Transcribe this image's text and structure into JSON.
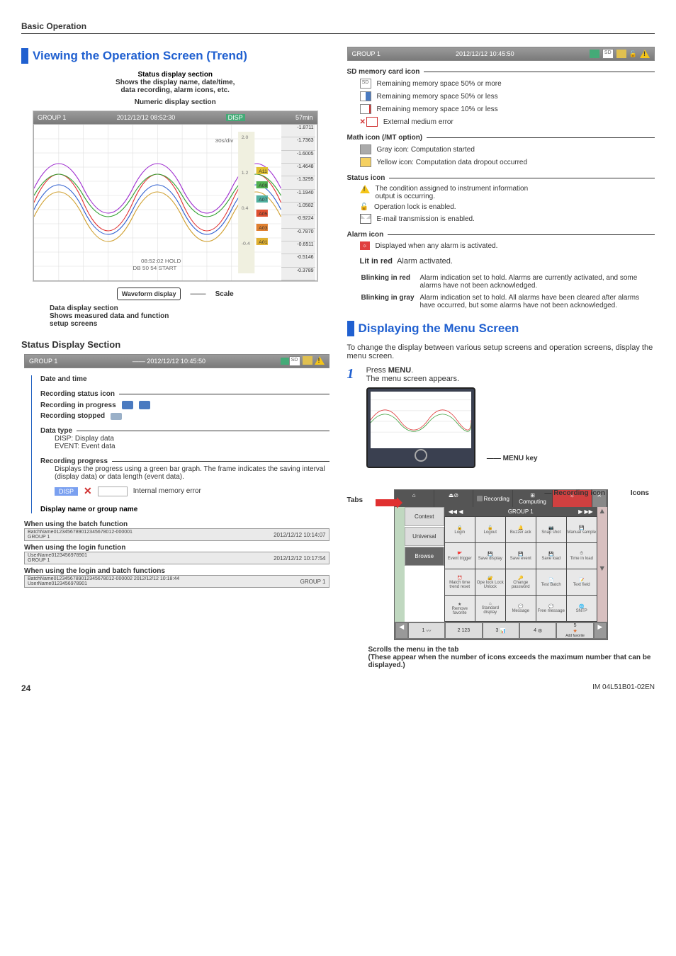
{
  "header": {
    "title": "Basic Operation"
  },
  "left": {
    "title1": "Viewing the Operation Screen (Trend)",
    "annot": {
      "status_title": "Status display section",
      "status_desc1": "Shows the display name, date/time,",
      "status_desc2": "data recording, alarm icons, etc.",
      "numeric": "Numeric display section",
      "waveform": "Waveform display",
      "scale": "Scale",
      "data_title": "Data display section",
      "data_desc1": "Shows measured data and function",
      "data_desc2": "setup screens"
    },
    "trend_statusbar": {
      "group": "GROUP 1",
      "datetime": "2012/12/12 08:52:30",
      "disp": "DISP",
      "period": "57min"
    },
    "trend_values": [
      "-1.8711",
      "-1.7363",
      "-1.6005",
      "-1.4648",
      "-1.3295",
      "-1.1940",
      "-1.0582",
      "-0.9224",
      "-0.7870",
      "-0.6511",
      "-0.5146",
      "-0.3789"
    ],
    "trend_scale_labels": [
      "30s/div",
      "2.0",
      "1.2",
      "0.4",
      "-0.4"
    ],
    "trend_time_labels": [
      "08:52:02 HOLD",
      "DB 50 54 START"
    ],
    "sub_title": "Status Display Section",
    "mini_statusbar": {
      "group": "GROUP 1",
      "datetime": "2012/12/12 10:45:50"
    },
    "block1": {
      "l1": "Date and time",
      "l2": "Recording status icon",
      "l3": "Recording in progress",
      "l4": "Recording stopped"
    },
    "block2": {
      "title": "Data type",
      "l1": "DISP: Display data",
      "l2": "EVENT: Event data"
    },
    "block3": {
      "title": "Recording progress",
      "desc": "Displays the progress using a green bar graph. The frame indicates the saving interval (display data) or data length (event data).",
      "disp_label": "DISP",
      "err": "Internal memory error"
    },
    "block4": {
      "title": "Display name or group name"
    },
    "batch": {
      "t1": "When using the batch function",
      "line1a": "BatchName0123456789012345678012-000001",
      "line1b": "2012/12/12 10:14:07",
      "line1c": "GROUP 1",
      "t2": "When using the login function",
      "line2a": "UserName0123456978901",
      "line2b": "2012/12/12 10:17:54",
      "line2c": "GROUP 1",
      "t3": "When using the login and batch functions",
      "line3a": "BatchName0123456789012345678012-000002",
      "line3b": "2012/12/12 10:18:44",
      "line3c": "UserName0123456978901",
      "line3d": "GROUP 1"
    }
  },
  "right": {
    "statusbar": {
      "group": "GROUP 1",
      "datetime": "2012/12/12 10:45:50"
    },
    "sd": {
      "title": "SD memory card icon",
      "r1": "Remaining memory space 50% or more",
      "r2": "Remaining memory space 50% or less",
      "r3": "Remaining memory space 10% or less",
      "r4": "External medium error"
    },
    "math": {
      "title": "Math icon (/MT option)",
      "r1": "Gray icon: Computation started",
      "r2": "Yellow icon: Computation data dropout occurred"
    },
    "status": {
      "title": "Status icon",
      "r1a": "The condition assigned to instrument information",
      "r1b": "output is occurring.",
      "r2": "Operation lock is enabled.",
      "r3": "E-mail transmission is enabled."
    },
    "alarm": {
      "title": "Alarm icon",
      "r1": "Displayed when any alarm is activated.",
      "lit_label": "Lit in red",
      "lit_desc": "Alarm activated.",
      "blink_red_label": "Blinking in red",
      "blink_red_desc": "Alarm indication set to hold. Alarms are currently activated, and some alarms have not been acknowledged.",
      "blink_gray_label": "Blinking in gray",
      "blink_gray_desc": "Alarm indication set to hold. All alarms have been cleared after alarms have occurred, but some alarms have not been acknowledged."
    },
    "menu": {
      "title": "Displaying the Menu Screen",
      "intro": "To change the display between various setup screens and operation screens, display the menu screen.",
      "step1a": "Press ",
      "step1b": "MENU",
      "step1c": ".",
      "step1d": "The menu screen appears.",
      "menu_key": "MENU key",
      "tabs_label": "Tabs",
      "rec_icon": "Recording icon",
      "icons_label": "Icons",
      "scroll1": "Scrolls the menu in the tab",
      "scroll2": "(These appear when the number of icons exceeds the maximum number that can be displayed.)"
    },
    "menu_statusbar": {
      "group": "GROUP 1"
    },
    "menu_tabs": {
      "browse": "Browse",
      "recording": "Recording",
      "computing": "Computing"
    },
    "menu_left_tabs": [
      "Context",
      "Universal",
      "Browse"
    ],
    "menu_icons": [
      "Login",
      "Logout",
      "Buzzer ack",
      "Snap shot",
      "Manual sample",
      "Event trigger",
      "Save display",
      "Save event",
      "Save load",
      "Time in load",
      "Match time trend reset",
      "Ope lock Lock Unlock",
      "Change password",
      "Test Batch",
      "Text field",
      "Remove favorite",
      "Standard display",
      "Message",
      "Free message",
      "SNTP"
    ],
    "bottom_bar_labels": [
      "1",
      "2",
      "3",
      "4",
      "5",
      "Add favorite"
    ]
  },
  "footer": {
    "page": "24",
    "doc": "IM 04L51B01-02EN"
  }
}
